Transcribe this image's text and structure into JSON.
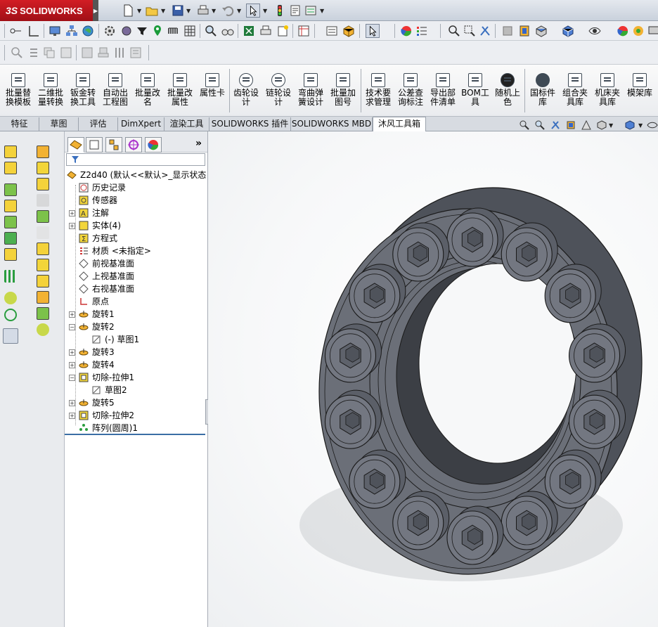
{
  "app": {
    "brand_prefix": "3S",
    "brand": "SOLIDWORKS"
  },
  "ribbon": {
    "buttons": [
      {
        "label": "批量替\n换模板"
      },
      {
        "label": "二维批\n量转换"
      },
      {
        "label": "钣金转\n换工具"
      },
      {
        "label": "自动出\n工程图"
      },
      {
        "label": "批量改\n名"
      },
      {
        "label": "批量改\n属性"
      },
      {
        "label": "属性卡"
      },
      {
        "label": "齿轮设\n计"
      },
      {
        "label": "链轮设\n计"
      },
      {
        "label": "弯曲弹\n簧设计"
      },
      {
        "label": "批量加\n图号"
      },
      {
        "label": "技术要\n求管理"
      },
      {
        "label": "公差查\n询标注"
      },
      {
        "label": "导出部\n件清单"
      },
      {
        "label": "BOM工\n具"
      },
      {
        "label": "随机上\n色"
      },
      {
        "label": "国标件\n库"
      },
      {
        "label": "组合夹\n具库"
      },
      {
        "label": "机床夹\n具库"
      },
      {
        "label": "模架库"
      }
    ]
  },
  "tabs": [
    {
      "label": "特征"
    },
    {
      "label": "草图"
    },
    {
      "label": "评估"
    },
    {
      "label": "DimXpert"
    },
    {
      "label": "渲染工具"
    },
    {
      "label": "SOLIDWORKS 插件"
    },
    {
      "label": "SOLIDWORKS MBD"
    },
    {
      "label": "沐风工具箱"
    }
  ],
  "feature_tree": {
    "expand_all": "»",
    "root": "Z2d40  (默认<<默认>_显示状态",
    "items": [
      {
        "label": "历史记录",
        "expand": ""
      },
      {
        "label": "传感器",
        "expand": ""
      },
      {
        "label": "注解",
        "expand": "+"
      },
      {
        "label": "实体(4)",
        "expand": "+"
      },
      {
        "label": "方程式",
        "expand": ""
      },
      {
        "label": "材质 <未指定>",
        "expand": ""
      },
      {
        "label": "前视基准面",
        "expand": ""
      },
      {
        "label": "上视基准面",
        "expand": ""
      },
      {
        "label": "右视基准面",
        "expand": ""
      },
      {
        "label": "原点",
        "expand": ""
      },
      {
        "label": "旋转1",
        "expand": "+"
      },
      {
        "label": "旋转2",
        "expand": "−"
      },
      {
        "label": "(-) 草图1",
        "expand": ""
      },
      {
        "label": "旋转3",
        "expand": "+"
      },
      {
        "label": "旋转4",
        "expand": "+"
      },
      {
        "label": "切除-拉伸1",
        "expand": "−"
      },
      {
        "label": "草图2",
        "expand": ""
      },
      {
        "label": "旋转5",
        "expand": "+"
      },
      {
        "label": "切除-拉伸2",
        "expand": "+"
      },
      {
        "label": "阵列(圆周)1",
        "expand": ""
      }
    ]
  },
  "colors": {
    "ring_face": "#6b6f78",
    "ring_side": "#4e525a",
    "ring_dark": "#3c3f45",
    "bolt": "#737781",
    "edge": "#1a1a1a"
  }
}
